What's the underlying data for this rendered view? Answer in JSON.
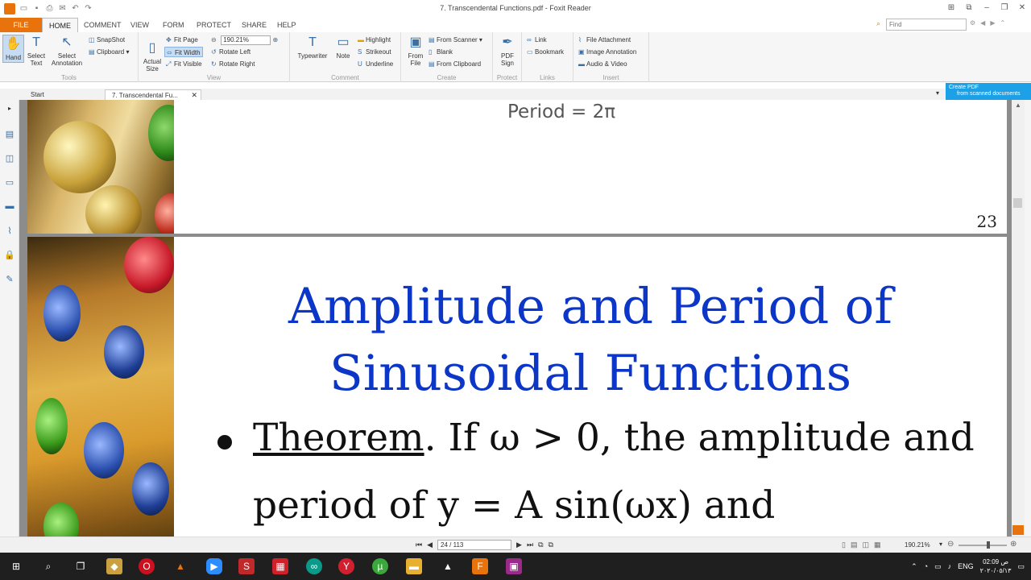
{
  "window": {
    "title": "7. Transcendental Functions.pdf - Foxit Reader",
    "find_placeholder": "Find"
  },
  "quick_access": [
    "open-icon",
    "save-icon",
    "print-icon",
    "email-icon",
    "undo-icon",
    "redo-icon"
  ],
  "menu_tabs": [
    "FILE",
    "HOME",
    "COMMENT",
    "VIEW",
    "FORM",
    "PROTECT",
    "SHARE",
    "HELP"
  ],
  "ribbon": {
    "tools": {
      "label": "Tools",
      "hand": "Hand",
      "select_text": "Select\nText",
      "select_annotation": "Select\nAnnotation",
      "snapshot": "SnapShot",
      "clipboard": "Clipboard"
    },
    "view": {
      "label": "View",
      "actual_size": "Actual\nSize",
      "fit_page": "Fit Page",
      "fit_width": "Fit Width",
      "fit_visible": "Fit Visible",
      "zoom": "190.21%",
      "rotate_left": "Rotate Left",
      "rotate_right": "Rotate Right"
    },
    "comment": {
      "label": "Comment",
      "typewriter": "Typewriter",
      "note": "Note",
      "highlight": "Highlight",
      "strikeout": "Strikeout",
      "underline": "Underline"
    },
    "create": {
      "label": "Create",
      "from_file": "From\nFile",
      "from_scanner": "From Scanner",
      "blank": "Blank",
      "from_clipboard": "From Clipboard"
    },
    "protect": {
      "label": "Protect",
      "pdf_sign": "PDF\nSign"
    },
    "links": {
      "label": "Links",
      "link": "Link",
      "bookmark": "Bookmark"
    },
    "insert": {
      "label": "Insert",
      "file_attachment": "File Attachment",
      "image_annotation": "Image Annotation",
      "audio_video": "Audio & Video"
    }
  },
  "doc_tabs": {
    "start": "Start",
    "current": "7. Transcendental Fu..."
  },
  "ad_banner": {
    "line1": "Create PDF",
    "line2": "from scanned documents"
  },
  "page_prev": {
    "formula": "Period = 2π",
    "page_number": "23"
  },
  "page_cur": {
    "title_line1": "Amplitude and Period of",
    "title_line2": "Sinusoidal Functions",
    "theorem_label": "Theorem",
    "theorem_text": ". If ω > 0, the amplitude and",
    "theorem_line2": "period of y = A sin(ωx) and"
  },
  "status": {
    "page": "24 / 113",
    "zoom": "190.21%"
  },
  "tray": {
    "language": "ENG",
    "time": "02:09 ص",
    "date": "٢٠٢٠/٠٥/١٣"
  },
  "colors": {
    "accent": "#e8720c",
    "title_blue": "#0b36c7",
    "ad_blue": "#1ca0e8"
  }
}
